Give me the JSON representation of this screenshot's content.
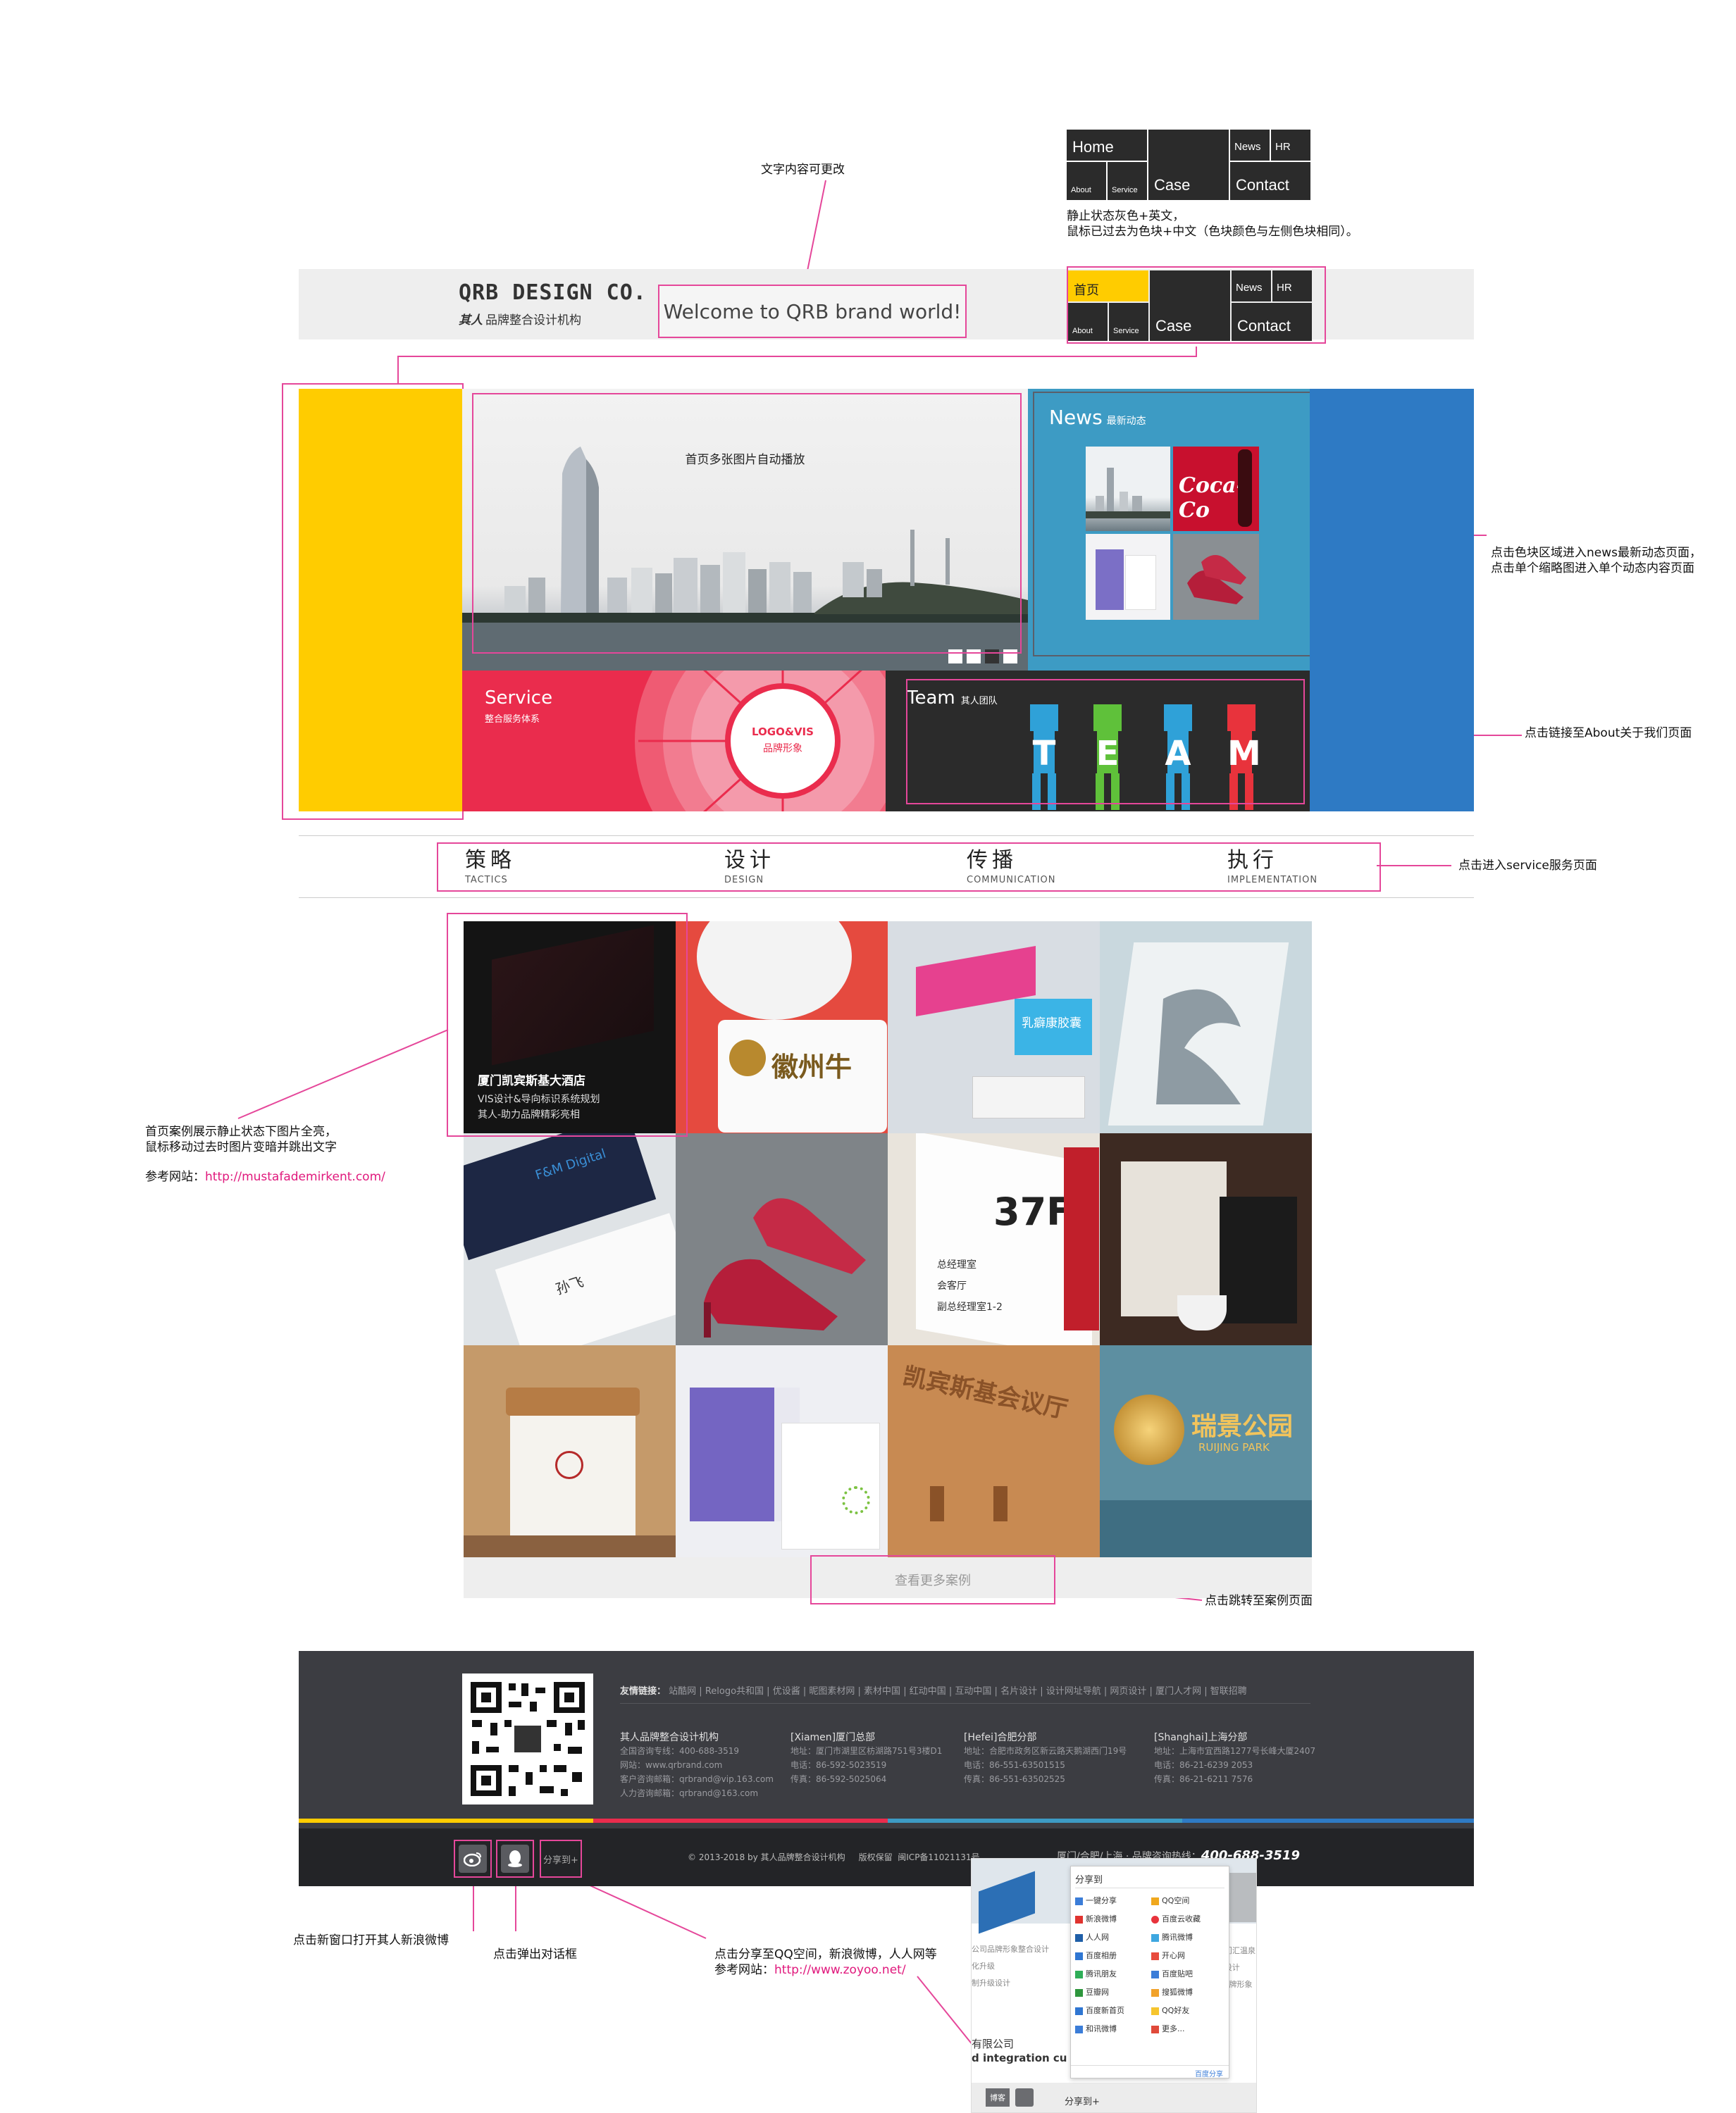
{
  "annotations": {
    "text_editable": "文字内容可更改",
    "nav_static": "静止状态灰色+英文，",
    "nav_hover": "鼠标已过去为色块+中文（色块颜色与左侧色块相同）。",
    "slideshow": "首页多张图片自动播放",
    "news_click_1": "点击色块区域进入news最新动态页面，",
    "news_click_2": "点击单个缩略图进入单个动态内容页面",
    "team_click": "点击链接至About关于我们页面",
    "service_click": "点击进入service服务页面",
    "cases_note_1": "首页案例展示静止状态下图片全亮，",
    "cases_note_2": "鼠标移动过去时图片变暗并跳出文字",
    "ref_label": "参考网站：",
    "ref_url": "http://mustafademirkent.com/",
    "more_click": "点击跳转至案例页面",
    "weibo_click": "点击新窗口打开其人新浪微博",
    "dialog_click": "点击弹出对话框",
    "share_click": "点击分享至QQ空间，新浪微博，人人网等",
    "share_ref_label": "参考网站：",
    "share_ref_url": "http://www.zoyoo.net/"
  },
  "nav_static": {
    "home": "Home",
    "news": "News",
    "hr": "HR",
    "about": "About",
    "service": "Service",
    "case": "Case",
    "contact": "Contact"
  },
  "header": {
    "logo_en": "QRB DESIGN CO.",
    "logo_mark": "其人",
    "logo_cn": "品牌整合设计机构",
    "welcome": "Welcome to QRB brand world!"
  },
  "nav_hover": {
    "home": "首页",
    "news": "News",
    "hr": "HR",
    "about": "About",
    "service": "Service",
    "case": "Case",
    "contact": "Contact"
  },
  "news": {
    "title": "News",
    "subtitle": "最新动态"
  },
  "service": {
    "title": "Service",
    "subtitle": "整合服务体系",
    "circle_line1": "LOGO&VIS",
    "circle_line2": "品牌形象"
  },
  "team": {
    "title": "Team",
    "subtitle": "其人团队",
    "letters": [
      "T",
      "E",
      "A",
      "M"
    ]
  },
  "strategy": [
    {
      "cn": "策略",
      "en": "TACTICS"
    },
    {
      "cn": "设计",
      "en": "DESIGN"
    },
    {
      "cn": "传播",
      "en": "COMMUNICATION"
    },
    {
      "cn": "执行",
      "en": "IMPLEMENTATION"
    }
  ],
  "cases": {
    "hover_title": "厦门凯宾斯基大酒店",
    "hover_line1": "VIS设计&导向标识系统规划",
    "hover_line2": "其人-助力品牌精彩亮相",
    "thumb_texts": {
      "tea": "徽州牛",
      "box": "乳癖康胶囊",
      "card_brand": "F&M Digital",
      "card_name": "孙飞",
      "sign_number": "37F",
      "sign_room1": "总经理室",
      "sign_room2": "会客厅",
      "sign_room3": "副总经理室1-2",
      "wood": "凯宾斯基会议厅",
      "park_cn": "瑞景公园",
      "park_en": "RUIJING PARK"
    },
    "more": "查看更多案例"
  },
  "footer": {
    "links_label": "友情链接：",
    "links": [
      "站酷网",
      "Relogo共和国",
      "优设酱",
      "昵图素材网",
      "素材中国",
      "红动中国",
      "互动中国",
      "名片设计",
      "设计网址导航",
      "网页设计",
      "厦门人才网",
      "智联招聘"
    ],
    "offices": [
      {
        "title": "其人品牌整合设计机构",
        "lines": [
          "全国咨询专线：400-688-3519",
          "网站：www.qrbrand.com",
          "客户咨询邮箱：qrbrand@vip.163.com",
          "人力咨询邮箱：qrbrand@163.com"
        ]
      },
      {
        "title": "[Xiamen]厦门总部",
        "lines": [
          "地址：厦门市湖里区枋湖路751号3楼D1",
          "电话：86-592-5023519",
          "传真：86-592-5025064"
        ]
      },
      {
        "title": "[Hefei]合肥分部",
        "lines": [
          "地址：合肥市政务区新云路天鹅湖西门19号",
          "电话：86-551-63501515",
          "传真：86-551-63502525"
        ]
      },
      {
        "title": "[Shanghai]上海分部",
        "lines": [
          "地址：上海市宜西路1277号长峰大厦2407",
          "电话：86-21-6239 2053",
          "传真：86-21-6211 7576"
        ]
      }
    ],
    "share_label": "分享到+",
    "copyright": "© 2013-2018 by 其人品牌整合设计机构     版权保留  闽ICP备11021131号",
    "hotline_label": "厦门/合肥/上海 · 品牌咨询热线：",
    "hotline": "400-688-3519"
  },
  "share_popup": {
    "title": "分享到",
    "items": [
      "一键分享",
      "QQ空间",
      "新浪微博",
      "百度云收藏",
      "人人网",
      "腾讯微博",
      "百度相册",
      "开心网",
      "腾讯朋友",
      "百度贴吧",
      "豆瓣网",
      "搜狐微博",
      "百度新首页",
      "QQ好友",
      "和讯微博",
      "更多..."
    ],
    "footer_brand": "百度分享",
    "bg_left1": "公司品牌形象整合设计",
    "bg_left2": "化升级",
    "bg_left3": "制升级设计",
    "bg_right1": "厦门汇温泉",
    "bg_right2": "VI设计",
    "bg_right3": "… 品牌形象升",
    "bg_company1": "有限公司",
    "bg_company2": "d integration cu",
    "bg_tag": "博客",
    "bg_share": "分享到+"
  },
  "colors": {
    "yellow": "#ffcc00",
    "news_blue": "#3d9bc4",
    "dark_blue": "#2e7ac4",
    "service_red": "#ea2c4d",
    "team_dark": "#2b2b2b",
    "annotation_pink": "#e5479a"
  }
}
